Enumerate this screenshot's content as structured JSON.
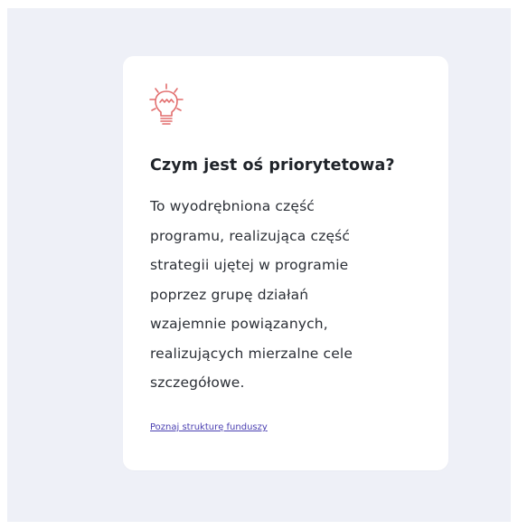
{
  "card": {
    "icon": "lightbulb-icon",
    "title": "Czym jest oś priorytetowa?",
    "body_lines": [
      "To wyodrębniona część",
      "programu, realizująca część",
      "strategii ujętej w programie",
      "poprzez grupę działań",
      "wzajemnie powiązanych,",
      "realizujących mierzalne cele",
      "szczegółowe."
    ],
    "link_label": "Poznaj strukturę funduszy"
  },
  "colors": {
    "page_background": "#eef0f7",
    "card_background": "#ffffff",
    "icon_accent": "#e26d6d",
    "link": "#4a3fb1"
  }
}
